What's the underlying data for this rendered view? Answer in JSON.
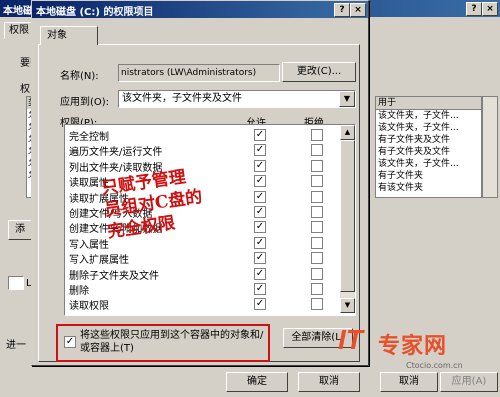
{
  "back": {
    "title": "本地磁",
    "tab": "权限",
    "text_yaoge": "要查",
    "text_quan": "权",
    "col_type": "类",
    "rows": [
      "允",
      "允",
      "允",
      "允",
      "允",
      "允"
    ],
    "right_header": "用于",
    "right_rows": [
      "该文件夹，子文件...",
      "该文件夹，子文件...",
      "有子文件夹及文件",
      "有子文件夹及文件",
      "该文件夹，子文件...",
      "有子文件夹",
      "有该文件夹"
    ],
    "stray_add_btn": "添",
    "check_label": "L",
    "jin_label": "进一",
    "ok": "确定",
    "cancel": "取消",
    "apply": "应用(A)",
    "close_glyph": "×",
    "help_glyph": "?"
  },
  "dialog": {
    "title": "本地磁盘 (C:) 的权限项目",
    "help_glyph": "?",
    "close_glyph": "×",
    "tab": "对象",
    "name_label": "名称(N):",
    "name_value": "nistrators (LW\\Administrators)",
    "change_button": "更改(C)...",
    "apply_to_label": "应用到(O):",
    "apply_to_value": "该文件夹，子文件夹及文件",
    "perm_label": "权限(P):",
    "allow_header": "允许",
    "deny_header": "拒绝",
    "permissions": [
      {
        "name": "完全控制",
        "allow": true,
        "deny": false
      },
      {
        "name": "遍历文件夹/运行文件",
        "allow": true,
        "deny": false
      },
      {
        "name": "列出文件夹/读取数据",
        "allow": true,
        "deny": false
      },
      {
        "name": "读取属性",
        "allow": true,
        "deny": false
      },
      {
        "name": "读取扩展属性",
        "allow": true,
        "deny": false
      },
      {
        "name": "创建文件/写入数据",
        "allow": true,
        "deny": false
      },
      {
        "name": "创建文件夹/附加数据",
        "allow": true,
        "deny": false
      },
      {
        "name": "写入属性",
        "allow": true,
        "deny": false
      },
      {
        "name": "写入扩展属性",
        "allow": true,
        "deny": false
      },
      {
        "name": "删除子文件夹及文件",
        "allow": true,
        "deny": false
      },
      {
        "name": "删除",
        "allow": true,
        "deny": false
      },
      {
        "name": "读取权限",
        "allow": true,
        "deny": false
      }
    ],
    "apply_checkbox_text": "将这些权限只应用到这个容器中的对象和/或容器上(T)",
    "apply_checkbox_checked": true,
    "clear_all_button": "全部清除(L)",
    "check_glyph": "✓",
    "annotation_lines": [
      "只赋予管理",
      "员组对C盘的",
      "完全权限"
    ]
  },
  "watermark": {
    "logo": "IT",
    "name": "专家网",
    "url": "Ctocio.com.cn"
  },
  "colors": {
    "titlebar_start": "#0a246a",
    "titlebar_end": "#3a6ea5",
    "annotation": "#d01010",
    "highlight_border": "#cc1111",
    "watermark": "#e8502a"
  }
}
